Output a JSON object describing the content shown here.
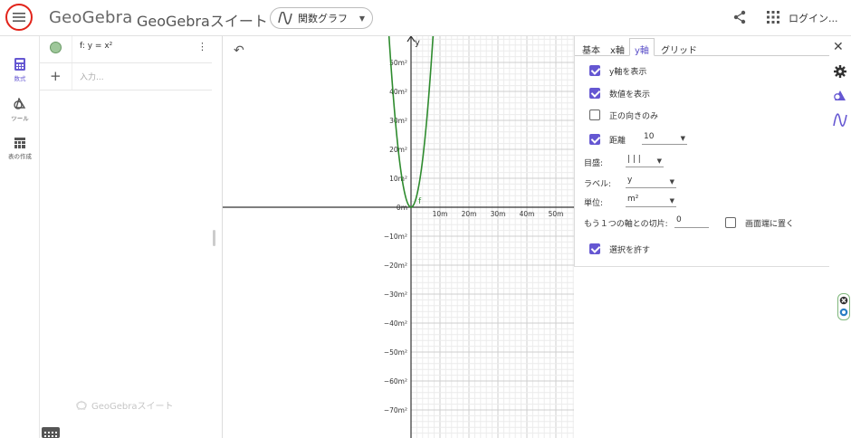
{
  "header": {
    "logo": "GeoGebra",
    "suite_title": "GeoGebraスイート",
    "app_selector": "関数グラフ",
    "login": "ログイン..."
  },
  "rail": {
    "items": [
      {
        "label": "数式",
        "icon": "calculator-icon"
      },
      {
        "label": "ツール",
        "icon": "tools-icon"
      },
      {
        "label": "表の作成",
        "icon": "table-icon"
      }
    ]
  },
  "algebra": {
    "formula": "f: y = x²",
    "input_placeholder": "入力...",
    "footer_brand": "GeoGebraスイート",
    "object_color": "#9ec79a"
  },
  "graph": {
    "axis_name_y": "y",
    "curve_label": "f",
    "curve_color": "#2e8b2e",
    "x_ticks": [
      "10m",
      "20m",
      "30m",
      "40m",
      "50m"
    ],
    "y_ticks": [
      "50m²",
      "40m²",
      "30m²",
      "20m²",
      "10m²",
      "0m",
      "−10m²",
      "−20m²",
      "−30m²",
      "−40m²",
      "−50m²",
      "−60m²",
      "−70m²"
    ]
  },
  "properties": {
    "tabs": [
      "基本",
      "x軸",
      "y軸",
      "グリッド"
    ],
    "active_tab": "y軸",
    "show_axis": "y軸を表示",
    "show_numbers": "数値を表示",
    "positive_only": "正の向きのみ",
    "distance_label": "距離",
    "distance_value": "10",
    "ticks_label": "目盛:",
    "ticks_value": "| | |",
    "axis_label_label": "ラベル:",
    "axis_label_value": "y",
    "unit_label": "単位:",
    "unit_value": "m²",
    "cross_label": "もう１つの軸との切片:",
    "cross_value": "0",
    "stick_edge": "画面端に置く",
    "allow_selection": "選択を許す",
    "accent_color": "#6557d2"
  }
}
